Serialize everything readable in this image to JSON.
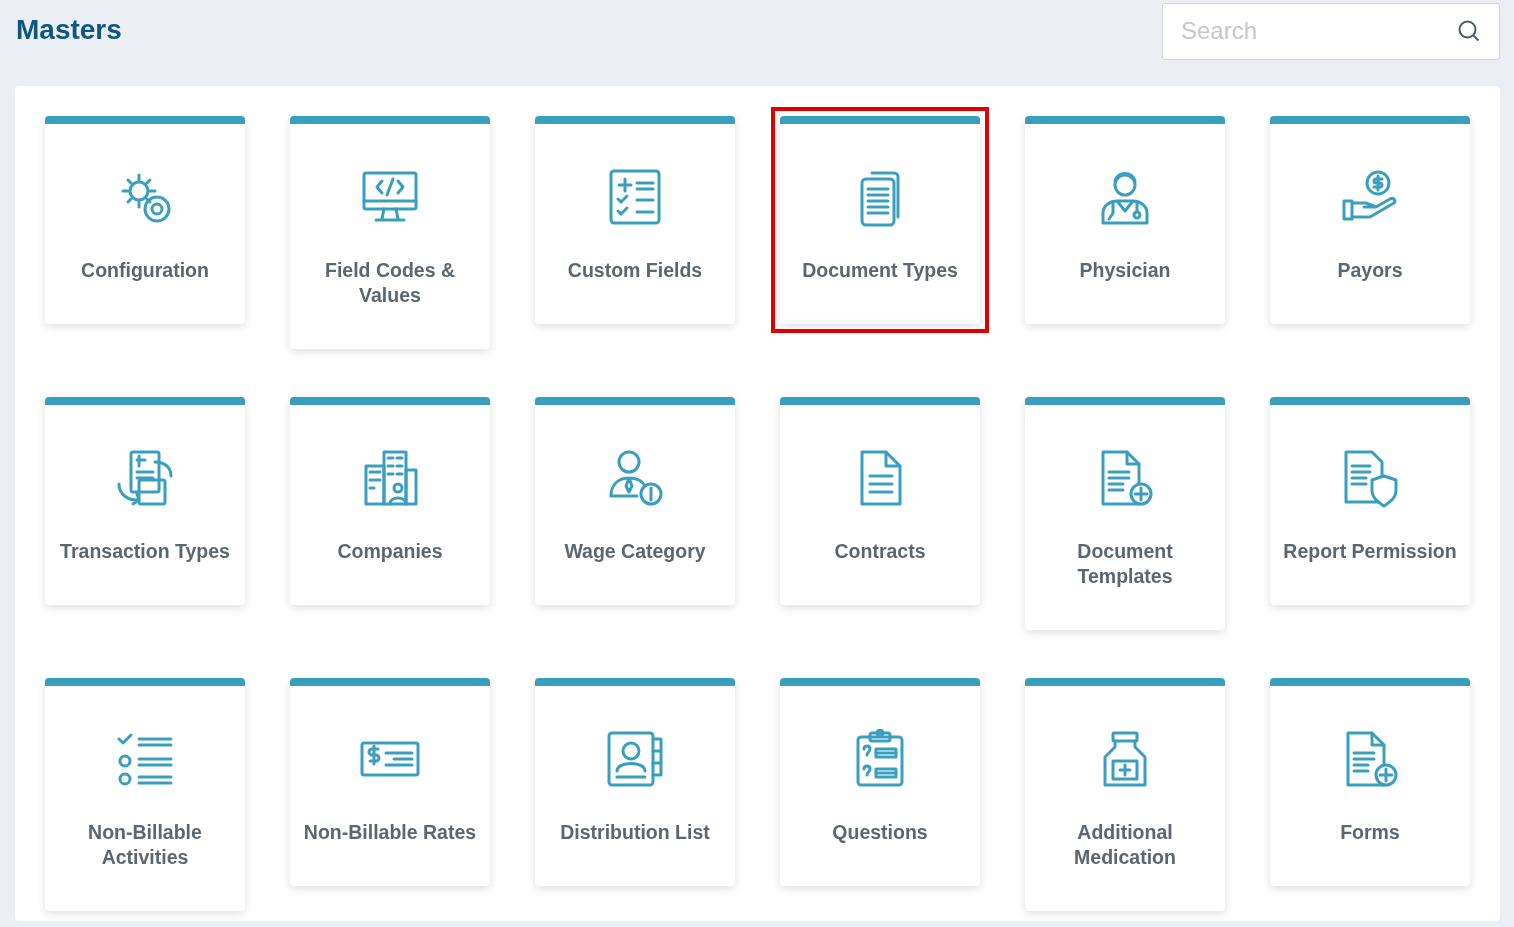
{
  "header": {
    "title": "Masters",
    "search": {
      "placeholder": "Search"
    }
  },
  "tiles": [
    {
      "label": "Configuration",
      "selected": false
    },
    {
      "label": "Field Codes & Values",
      "selected": false
    },
    {
      "label": "Custom Fields",
      "selected": false
    },
    {
      "label": "Document Types",
      "selected": true
    },
    {
      "label": "Physician",
      "selected": false
    },
    {
      "label": "Payors",
      "selected": false
    },
    {
      "label": "Transaction Types",
      "selected": false
    },
    {
      "label": "Companies",
      "selected": false
    },
    {
      "label": "Wage Category",
      "selected": false
    },
    {
      "label": "Contracts",
      "selected": false
    },
    {
      "label": "Document Templates",
      "selected": false
    },
    {
      "label": "Report Permission",
      "selected": false
    },
    {
      "label": "Non-Billable Activities",
      "selected": false
    },
    {
      "label": "Non-Billable Rates",
      "selected": false
    },
    {
      "label": "Distribution List",
      "selected": false
    },
    {
      "label": "Questions",
      "selected": false
    },
    {
      "label": "Additional Medication",
      "selected": false
    },
    {
      "label": "Forms",
      "selected": false
    }
  ]
}
